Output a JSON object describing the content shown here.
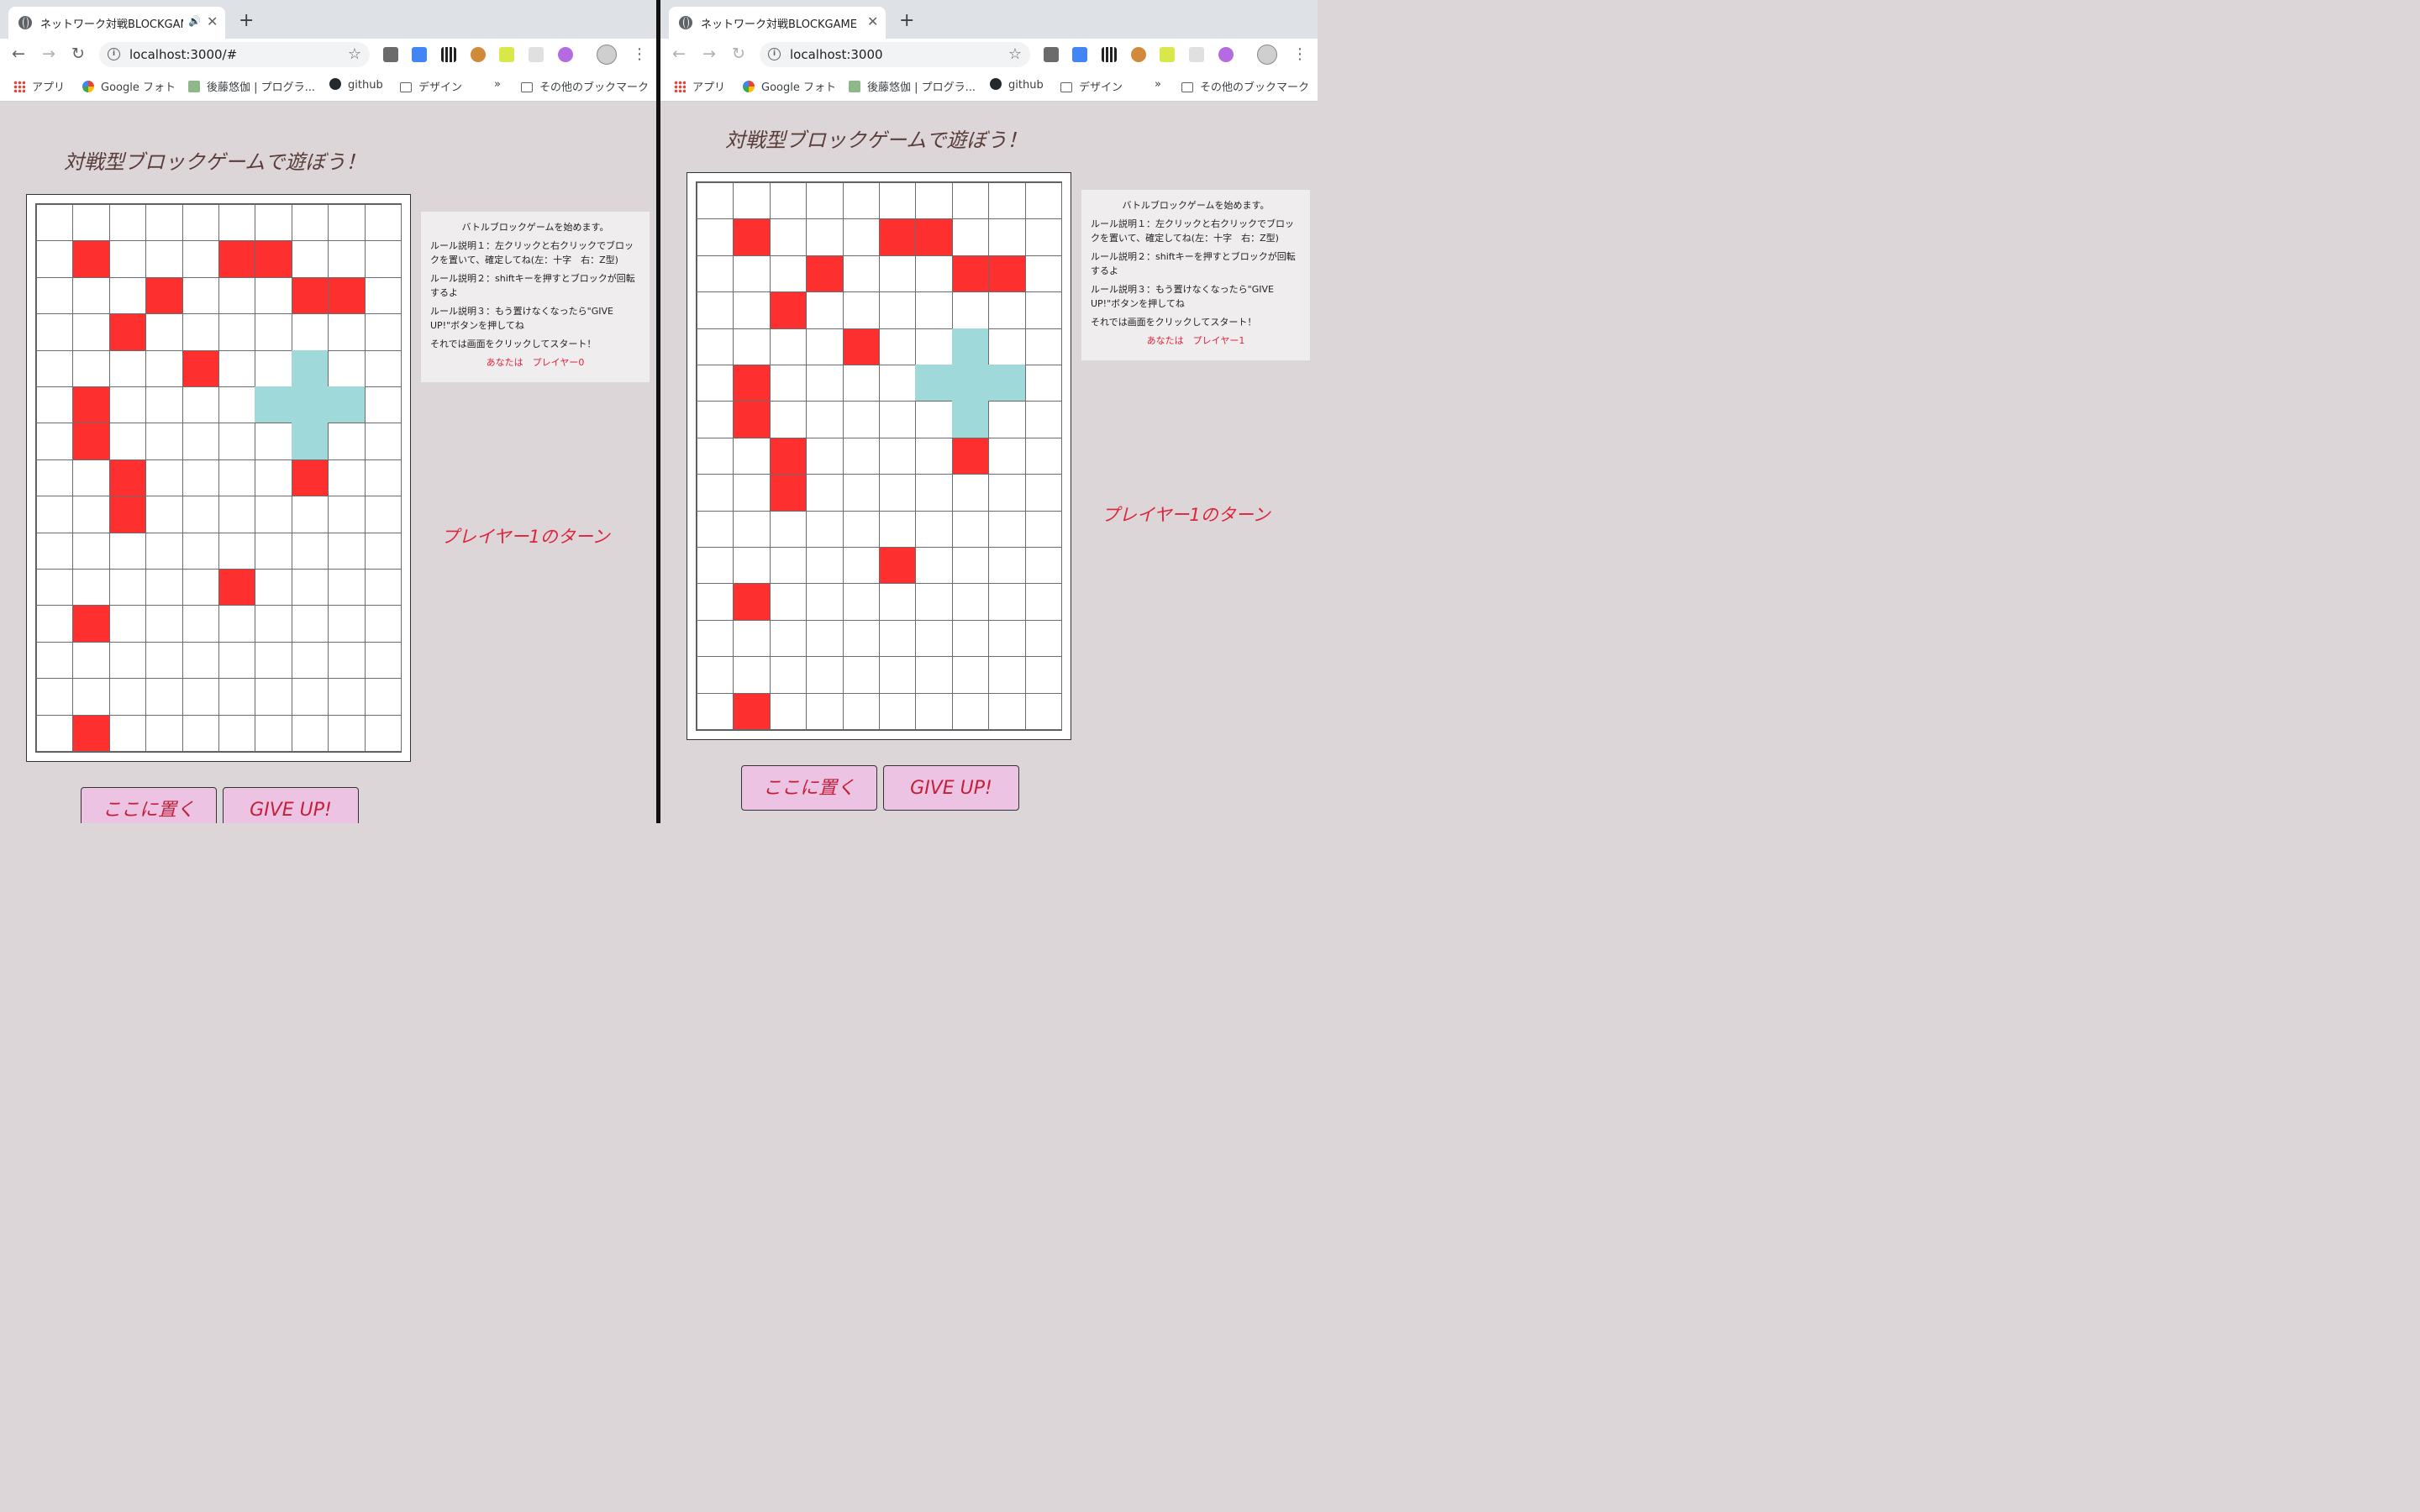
{
  "browser": {
    "new_tab_icon": "+",
    "close_icon": "✕",
    "speaker_icon": "🔊",
    "bookmarks": {
      "apps": "アプリ",
      "photos": "Google フォト",
      "blog": "後藤悠伽 | プログラ...",
      "github": "github",
      "design": "デザイン",
      "overflow": "»",
      "other": "その他のブックマーク"
    }
  },
  "windows": [
    {
      "tab_title": "ネットワーク対戦BLOCKGAME",
      "url": "localhost:3000/#",
      "heading": "対戦型ブロックゲームで遊ぼう！",
      "info": {
        "intro": "バトルブロックゲームを始めます。",
        "rule1": "ルール説明１：左クリックと右クリックでブロックを置いて、確定してね(左：十字　右：Z型)",
        "rule2": "ルール説明２：shiftキーを押すとブロックが回転するよ",
        "rule3": "ルール説明３：もう置けなくなったら\"GIVE UP!\"ボタンを押してね",
        "start": "それでは画面をクリックしてスタート！",
        "you": "あなたは　プレイヤー0"
      },
      "turn": "プレイヤー1のターン",
      "place_button": "ここに置く",
      "giveup_button": "GIVE UP!",
      "board": {
        "cols": 10,
        "rows": 15,
        "red": [
          [
            1,
            1
          ],
          [
            5,
            1
          ],
          [
            6,
            1
          ],
          [
            3,
            2
          ],
          [
            7,
            2
          ],
          [
            8,
            2
          ],
          [
            2,
            3
          ],
          [
            4,
            4
          ],
          [
            1,
            5
          ],
          [
            1,
            6
          ],
          [
            2,
            7
          ],
          [
            7,
            7
          ],
          [
            2,
            8
          ],
          [
            5,
            10
          ],
          [
            1,
            11
          ],
          [
            1,
            14
          ]
        ],
        "cyan": [
          [
            7,
            4
          ],
          [
            6,
            5
          ],
          [
            7,
            5
          ],
          [
            8,
            5
          ],
          [
            7,
            6
          ]
        ]
      }
    },
    {
      "tab_title": "ネットワーク対戦BLOCKGAME",
      "url": "localhost:3000",
      "heading": "対戦型ブロックゲームで遊ぼう！",
      "info": {
        "intro": "バトルブロックゲームを始めます。",
        "rule1": "ルール説明１：左クリックと右クリックでブロックを置いて、確定してね(左：十字　右：Z型)",
        "rule2": "ルール説明２：shiftキーを押すとブロックが回転するよ",
        "rule3": "ルール説明３：もう置けなくなったら\"GIVE UP!\"ボタンを押してね",
        "start": "それでは画面をクリックしてスタート！",
        "you": "あなたは　プレイヤー1"
      },
      "turn": "プレイヤー1のターン",
      "place_button": "ここに置く",
      "giveup_button": "GIVE UP!",
      "board": {
        "cols": 10,
        "rows": 15,
        "red": [
          [
            1,
            1
          ],
          [
            5,
            1
          ],
          [
            6,
            1
          ],
          [
            3,
            2
          ],
          [
            7,
            2
          ],
          [
            8,
            2
          ],
          [
            2,
            3
          ],
          [
            4,
            4
          ],
          [
            1,
            5
          ],
          [
            1,
            6
          ],
          [
            2,
            7
          ],
          [
            7,
            7
          ],
          [
            2,
            8
          ],
          [
            5,
            10
          ],
          [
            1,
            11
          ],
          [
            1,
            14
          ]
        ],
        "cyan": [
          [
            7,
            4
          ],
          [
            6,
            5
          ],
          [
            7,
            5
          ],
          [
            8,
            5
          ],
          [
            7,
            6
          ]
        ]
      }
    }
  ],
  "colors": {
    "red_block": "#fe2f2f",
    "cyan_preview": "#9fd9da",
    "accent_text": "#e0223c",
    "button_bg": "#ecc3e2",
    "page_bg": "#dcd6d8"
  }
}
